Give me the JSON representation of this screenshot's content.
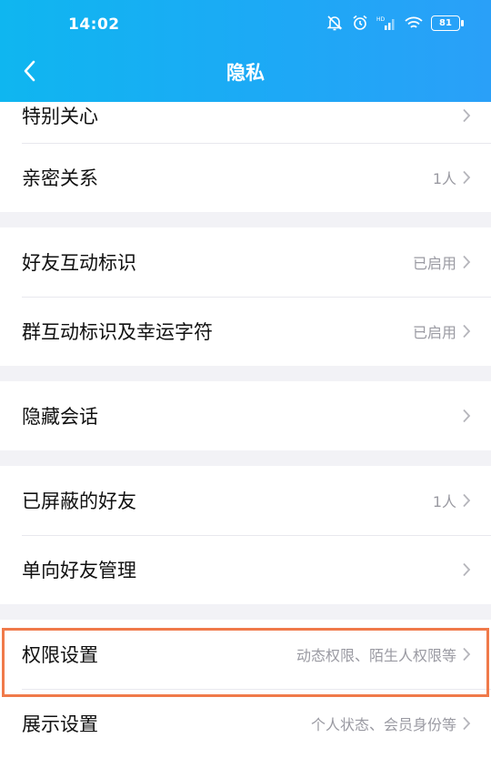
{
  "status_bar": {
    "time": "14:02",
    "battery": "81"
  },
  "header": {
    "title": "隐私"
  },
  "groups": [
    [
      {
        "label": "特别关心",
        "value": ""
      },
      {
        "label": "亲密关系",
        "value": "1人"
      }
    ],
    [
      {
        "label": "好友互动标识",
        "value": "已启用"
      },
      {
        "label": "群互动标识及幸运字符",
        "value": "已启用"
      }
    ],
    [
      {
        "label": "隐藏会话",
        "value": ""
      }
    ],
    [
      {
        "label": "已屏蔽的好友",
        "value": "1人"
      },
      {
        "label": "单向好友管理",
        "value": ""
      }
    ],
    [
      {
        "label": "权限设置",
        "value": "动态权限、陌生人权限等"
      },
      {
        "label": "展示设置",
        "value": "个人状态、会员身份等"
      }
    ]
  ],
  "colors": {
    "header_gradient_start": "#0fb6f0",
    "header_gradient_end": "#2aa0f8",
    "highlight_border": "#f07a4a"
  }
}
